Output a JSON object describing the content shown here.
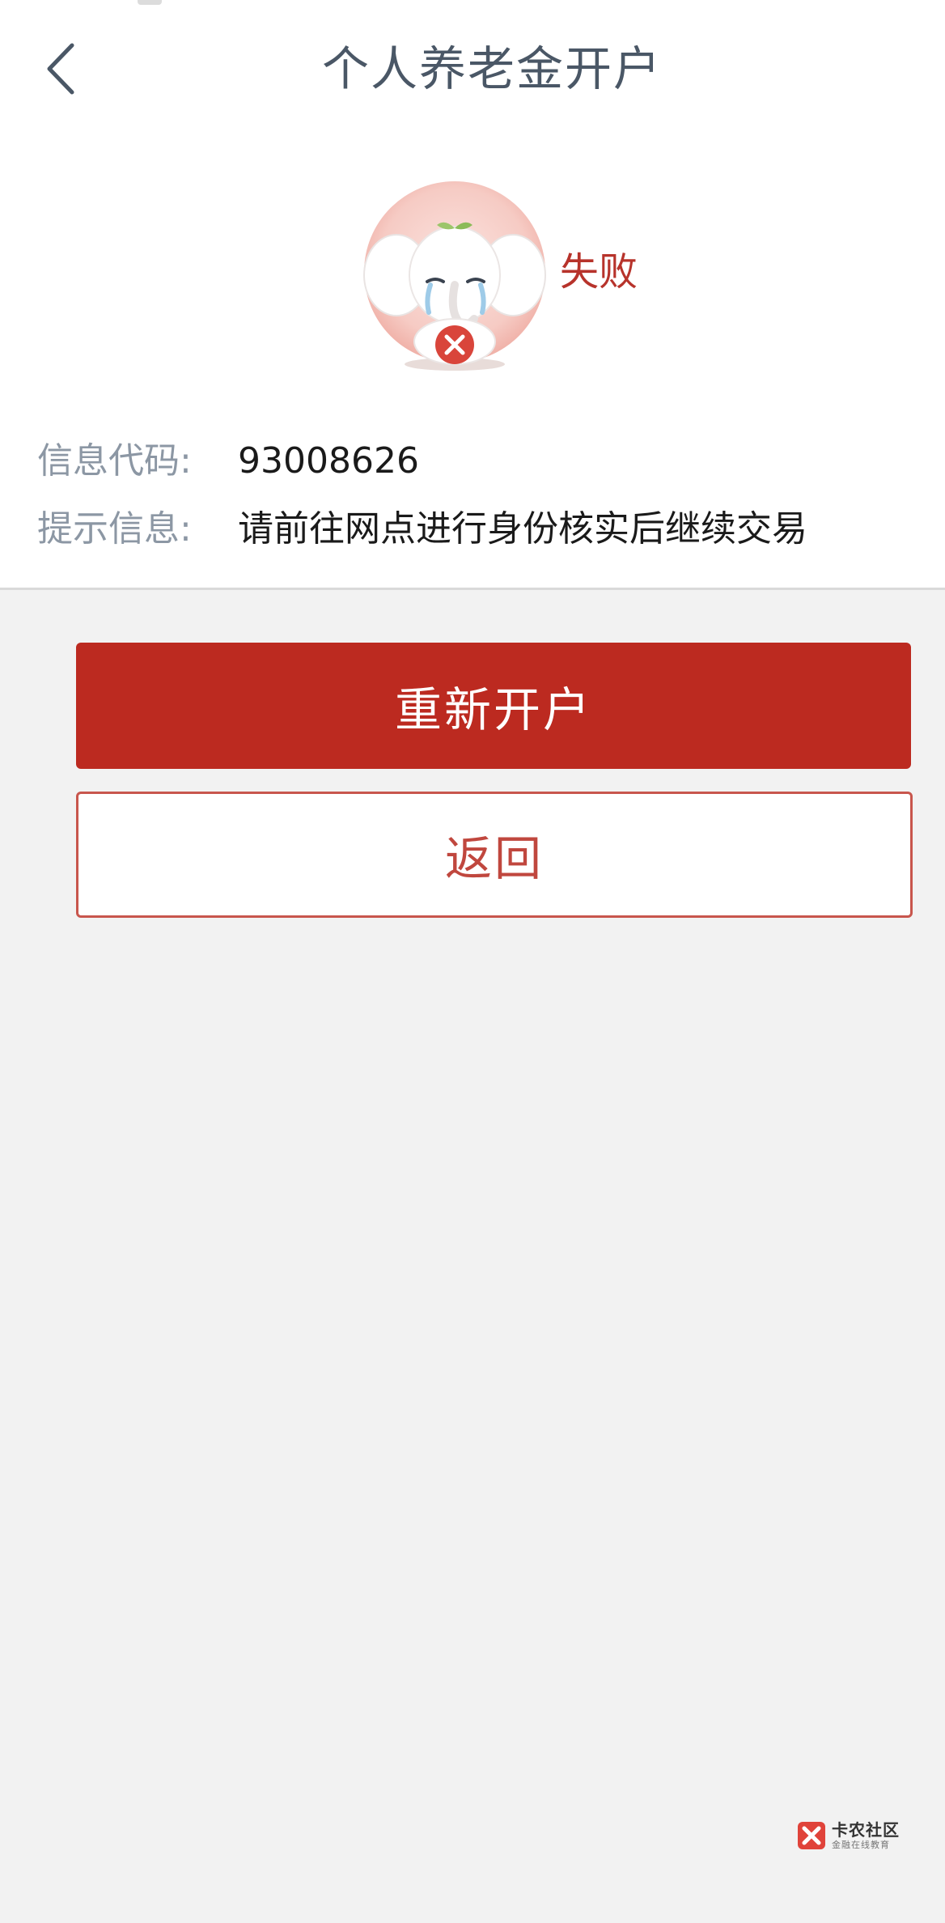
{
  "header": {
    "title": "个人养老金开户",
    "back_icon": "chevron-left-icon"
  },
  "result": {
    "status": "失败",
    "mascot_icon": "crying-elephant-icon",
    "fail_badge_icon": "close-icon"
  },
  "details": {
    "code_label": "信息代码:",
    "code_value": "93008626",
    "hint_label": "提示信息:",
    "hint_value": "请前往网点进行身份核实后继续交易"
  },
  "actions": {
    "retry_label": "重新开户",
    "back_label": "返回"
  },
  "watermark": {
    "title": "卡农社区",
    "subtitle": "金融在线教育"
  },
  "colors": {
    "accent": "#bc2a20",
    "status_text": "#b7332b",
    "title": "#4a5766",
    "label": "#8c97a4",
    "page_bg": "#f2f2f2"
  }
}
